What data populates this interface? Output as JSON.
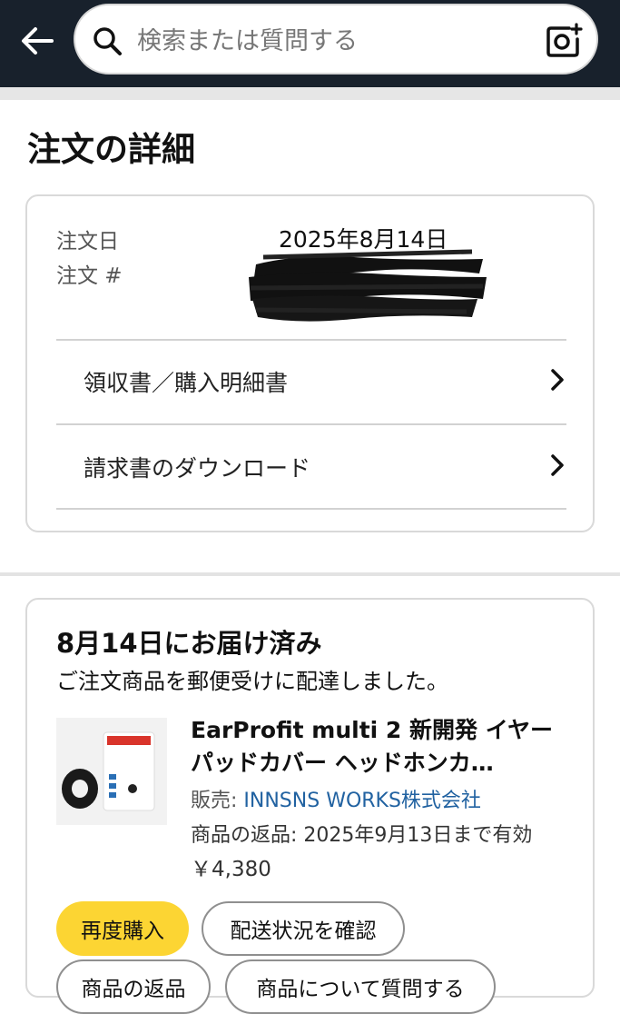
{
  "header": {
    "search_placeholder": "検索または質問する",
    "icons": {
      "back": "back-arrow-icon",
      "search": "search-icon",
      "camera": "camera-search-icon"
    }
  },
  "page": {
    "title": "注文の詳細"
  },
  "order_info": {
    "date_label": "注文日",
    "date_value": "2025年8月14日",
    "number_label": "注文 #",
    "links": [
      {
        "label": "領収書／購入明細書"
      },
      {
        "label": "請求書のダウンロード"
      }
    ]
  },
  "shipment": {
    "status": "8月14日にお届け済み",
    "note": "ご注文商品を郵便受けに配達しました。",
    "product": {
      "title": "EarProfit multi 2 新開発 イヤーパッドカバー ヘッドホンカ…",
      "seller_label": "販売: ",
      "seller_name": "INNSNS WORKS株式会社",
      "return_text": "商品の返品: 2025年9月13日まで有効",
      "price": "￥4,380"
    },
    "buttons": {
      "buy_again": "再度購入",
      "track": "配送状況を確認",
      "return": "商品の返品",
      "ask": "商品について質問する"
    }
  },
  "colors": {
    "header_bg": "#18212c",
    "buy_again_bg": "#fcd533",
    "link": "#2162a1"
  }
}
